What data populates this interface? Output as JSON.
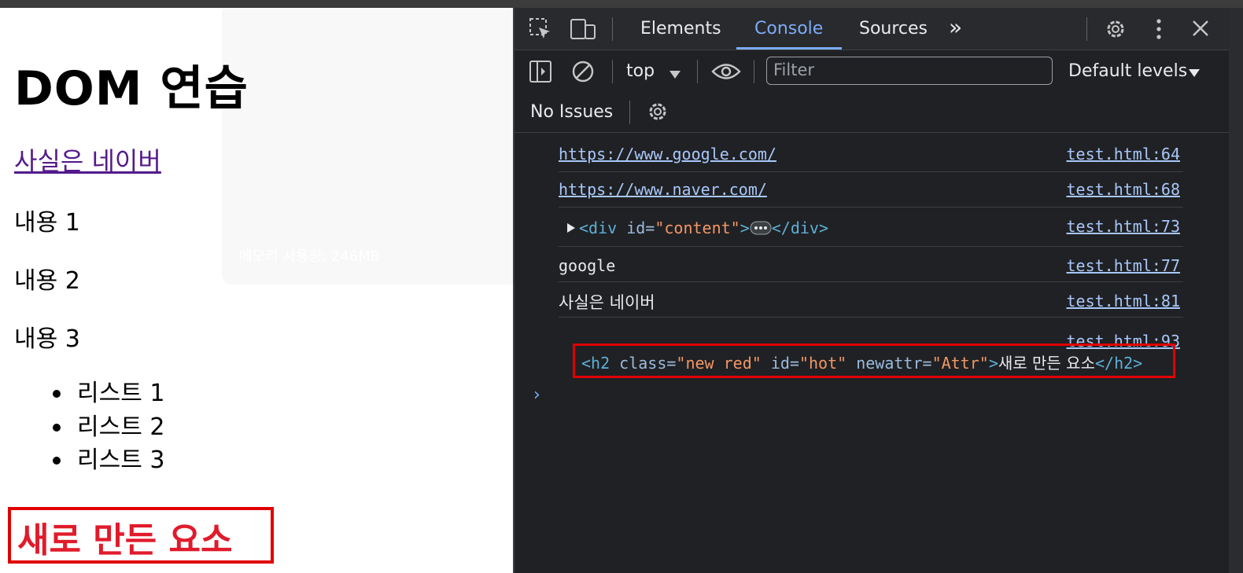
{
  "page": {
    "title": "DOM 연습",
    "link_text": "사실은 네이버",
    "paragraphs": [
      "내용 1",
      "내용 2",
      "내용 3"
    ],
    "list_items": [
      "리스트 1",
      "리스트 2",
      "리스트 3"
    ],
    "new_element_text": "새로 만든 요소",
    "overlay_text": "메모리 사용량: 246MB"
  },
  "devtools": {
    "tabs": [
      "Elements",
      "Console",
      "Sources"
    ],
    "active_tab": "Console",
    "more_tabs": "»",
    "context": "top",
    "filter_placeholder": "Filter",
    "levels": "Default levels",
    "issues": "No Issues",
    "logs": [
      {
        "message": "https://www.google.com/",
        "source": "test.html:64"
      },
      {
        "message": "https://www.naver.com/",
        "source": "test.html:68"
      },
      {
        "message": "<div id=\"content\">…</div>",
        "source": "test.html:73"
      },
      {
        "message": "google",
        "source": "test.html:77"
      },
      {
        "message": "사실은 네이버",
        "source": "test.html:81"
      },
      {
        "message": "",
        "source": "test.html:93"
      }
    ],
    "div_log": {
      "tag_open": "<div ",
      "attr": "id=",
      "value": "\"content\"",
      "close": ">",
      "end": "</div>"
    },
    "h2_log": {
      "open": "<h2 ",
      "attr1": "class=",
      "val1": "\"new red\"",
      "attr2": " id=",
      "val2": "\"hot\"",
      "attr3": " newattr=",
      "val3": "\"Attr\"",
      "gt": ">",
      "text": "새로 만든 요소",
      "close": "</h2>"
    },
    "prompt": "›",
    "colors": {
      "accent": "#7cacf8",
      "tag": "#5db0d7",
      "attr_value": "#f29766",
      "highlight_box": "#e00000",
      "new_element": "#e01b2b"
    }
  }
}
